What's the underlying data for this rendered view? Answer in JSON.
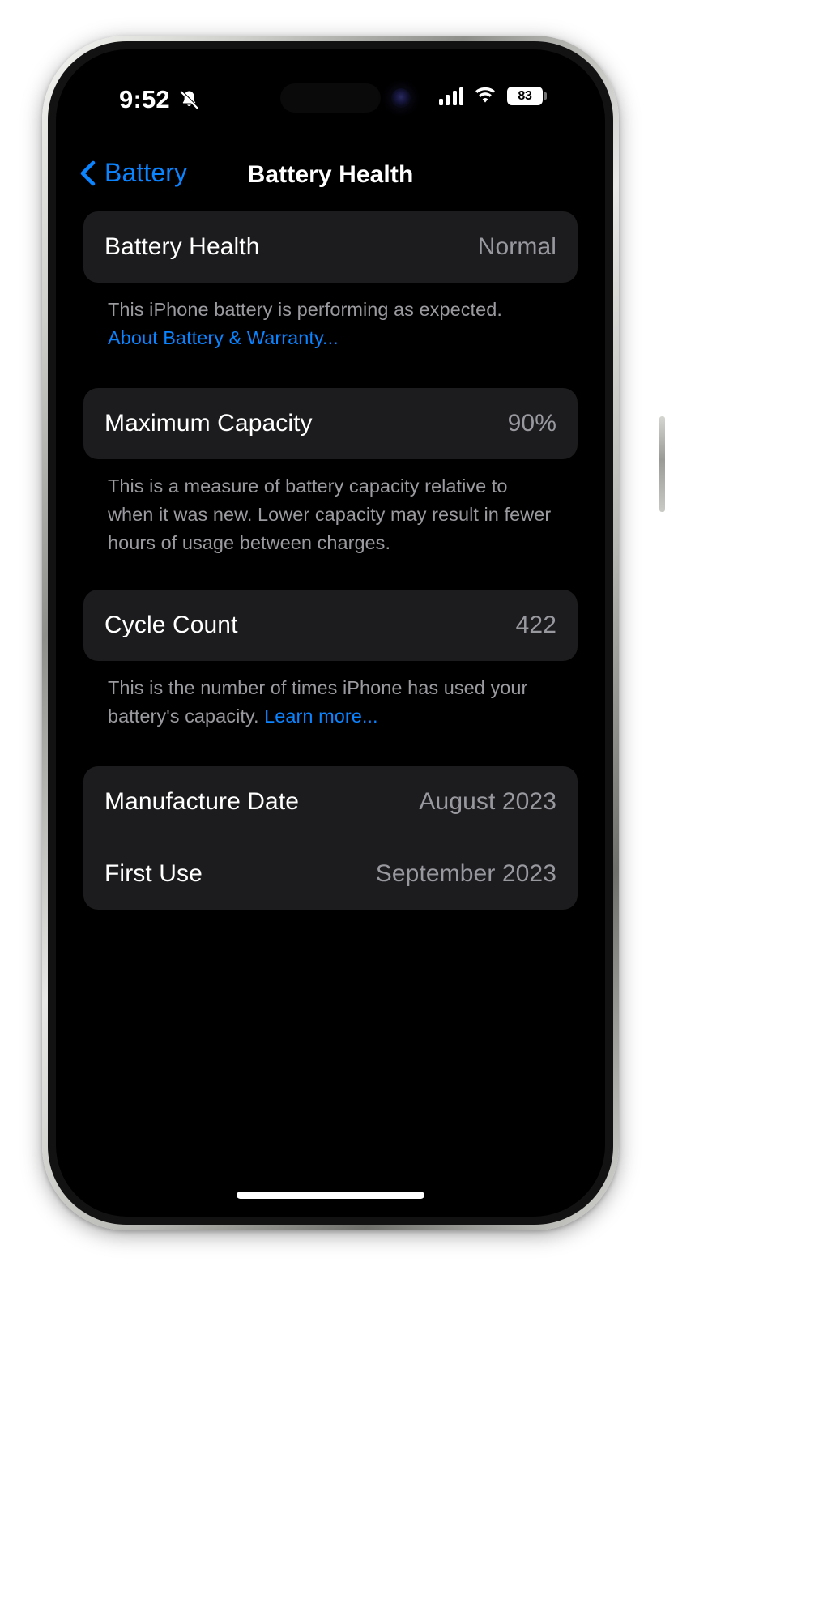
{
  "status_bar": {
    "time": "9:52",
    "silent_icon": "bell-slash-icon",
    "signal_icon": "cellular-signal-icon",
    "wifi_icon": "wifi-icon",
    "battery_percent": "83",
    "battery_icon": "battery-icon"
  },
  "nav": {
    "back_icon": "chevron-left-icon",
    "back_label": "Battery",
    "title": "Battery Health"
  },
  "sections": {
    "battery_health": {
      "label": "Battery Health",
      "value": "Normal",
      "footer_text": "This iPhone battery is performing as expected. ",
      "footer_link": "About Battery & Warranty..."
    },
    "maximum_capacity": {
      "label": "Maximum Capacity",
      "value": "90%",
      "footer_text": "This is a measure of battery capacity relative to when it was new. Lower capacity may result in fewer hours of usage between charges."
    },
    "cycle_count": {
      "label": "Cycle Count",
      "value": "422",
      "footer_text": "This is the number of times iPhone has used your battery's capacity. ",
      "footer_link": "Learn more..."
    },
    "dates": {
      "manufacture_label": "Manufacture Date",
      "manufacture_value": "August 2023",
      "first_use_label": "First Use",
      "first_use_value": "September 2023"
    }
  },
  "colors": {
    "accent": "#0a84ff",
    "card": "#1c1c1e",
    "background": "#000000",
    "secondary_text": "#98989f"
  }
}
